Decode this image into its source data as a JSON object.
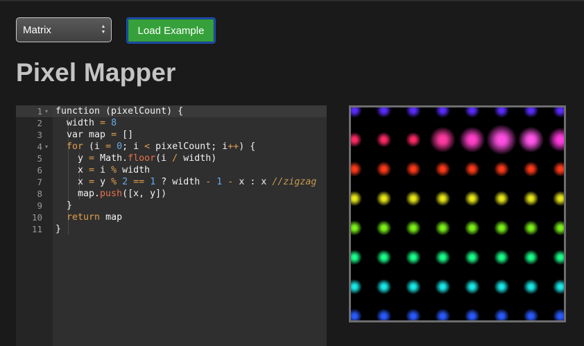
{
  "toolbar": {
    "select": {
      "value": "Matrix"
    },
    "load_label": "Load Example"
  },
  "page": {
    "title": "Pixel Mapper"
  },
  "editor": {
    "line_numbers": [
      "1",
      "2",
      "3",
      "4",
      "5",
      "6",
      "7",
      "8",
      "9",
      "10",
      "11"
    ],
    "lines": [
      [
        [
          "plain",
          "function (pixelCount) {"
        ]
      ],
      [
        [
          "plain",
          "  width "
        ],
        [
          "op",
          "="
        ],
        [
          "plain",
          " "
        ],
        [
          "num",
          "8"
        ]
      ],
      [
        [
          "plain",
          "  var map "
        ],
        [
          "op",
          "="
        ],
        [
          "plain",
          " []"
        ]
      ],
      [
        [
          "plain",
          "  "
        ],
        [
          "kw",
          "for"
        ],
        [
          "plain",
          " (i "
        ],
        [
          "op",
          "="
        ],
        [
          "plain",
          " "
        ],
        [
          "num",
          "0"
        ],
        [
          "plain",
          "; i "
        ],
        [
          "op",
          "<"
        ],
        [
          "plain",
          " pixelCount; i"
        ],
        [
          "op",
          "++"
        ],
        [
          "plain",
          ") {"
        ]
      ],
      [
        [
          "plain",
          "    y "
        ],
        [
          "op",
          "="
        ],
        [
          "plain",
          " Math."
        ],
        [
          "fn",
          "floor"
        ],
        [
          "plain",
          "(i "
        ],
        [
          "op",
          "/"
        ],
        [
          "plain",
          " width)"
        ]
      ],
      [
        [
          "plain",
          "    x "
        ],
        [
          "op",
          "="
        ],
        [
          "plain",
          " i "
        ],
        [
          "op",
          "%"
        ],
        [
          "plain",
          " width"
        ]
      ],
      [
        [
          "plain",
          "    x "
        ],
        [
          "op",
          "="
        ],
        [
          "plain",
          " y "
        ],
        [
          "op",
          "%"
        ],
        [
          "plain",
          " "
        ],
        [
          "num",
          "2"
        ],
        [
          "plain",
          " "
        ],
        [
          "op",
          "=="
        ],
        [
          "plain",
          " "
        ],
        [
          "num",
          "1"
        ],
        [
          "plain",
          " ? width "
        ],
        [
          "op",
          "-"
        ],
        [
          "plain",
          " "
        ],
        [
          "num",
          "1"
        ],
        [
          "plain",
          " "
        ],
        [
          "op",
          "-"
        ],
        [
          "plain",
          " x : x "
        ],
        [
          "cm",
          "//zigzag"
        ]
      ],
      [
        [
          "plain",
          "    map."
        ],
        [
          "fn",
          "push"
        ],
        [
          "plain",
          "([x, y])"
        ]
      ],
      [
        [
          "plain",
          "  }"
        ]
      ],
      [
        [
          "plain",
          "  "
        ],
        [
          "kw",
          "return"
        ],
        [
          "plain",
          " map"
        ]
      ],
      [
        [
          "plain",
          "}"
        ]
      ]
    ]
  },
  "preview": {
    "grid": {
      "cols": 8,
      "rows": 8
    },
    "row_colors": [
      "#5a2bff",
      "#ff2a66",
      "#ff3a1a",
      "#e8e81a",
      "#7cf21a",
      "#1aff8a",
      "#1ae8e8",
      "#2a5aff"
    ],
    "highlighted_row_index": 1,
    "highlight_colors": [
      "#ff2a66",
      "#ff3aa0",
      "#ff40c8",
      "#ff4fe0",
      "#ff55e8",
      "#ff3bdf"
    ]
  }
}
